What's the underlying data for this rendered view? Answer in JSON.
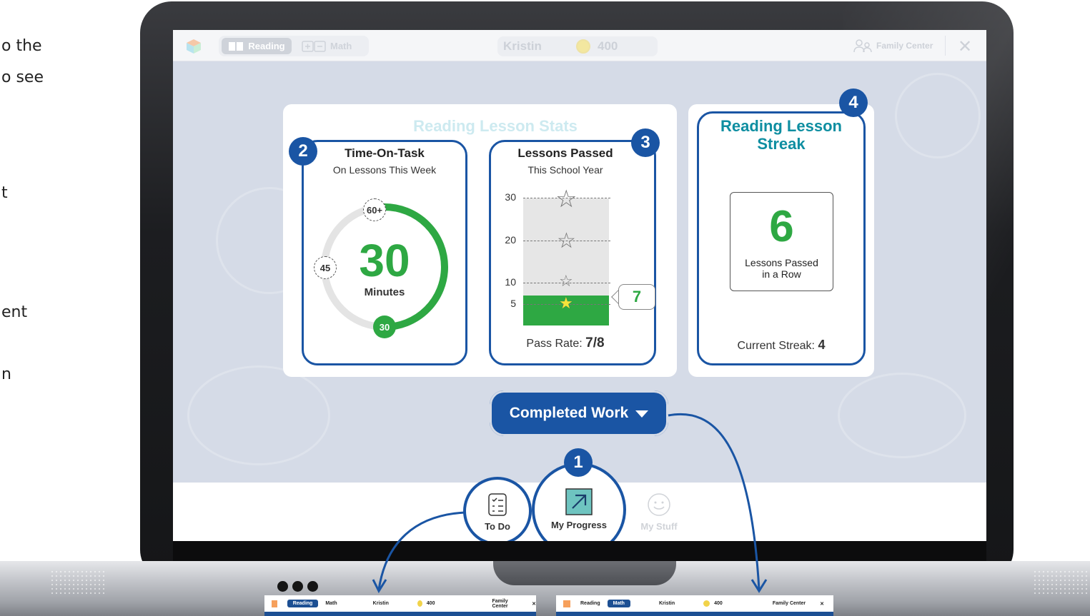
{
  "side_text": [
    "o the",
    "o see",
    "t",
    "ent",
    "n"
  ],
  "topbar": {
    "tab_reading": "Reading",
    "tab_math": "Math",
    "user_name": "Kristin",
    "coins": "400",
    "family_center": "Family Center",
    "close": "✕"
  },
  "stats": {
    "title": "Reading Lesson Stats",
    "time_on_task": {
      "badge": "2",
      "title": "Time-On-Task",
      "subtitle": "On Lessons This Week",
      "value": "30",
      "unit": "Minutes",
      "dial_labels": [
        "60+",
        "45",
        "30"
      ],
      "fraction_of_goal": 0.5
    },
    "lessons_passed": {
      "badge": "3",
      "title": "Lessons Passed",
      "subtitle": "This School Year",
      "ticks": [
        "30",
        "20",
        "10",
        "5"
      ],
      "value": "7",
      "value_number": 7,
      "max": 30,
      "pass_rate_label": "Pass Rate:",
      "pass_rate_value": "7/8"
    }
  },
  "streak": {
    "badge": "4",
    "title_line1": "Reading Lesson",
    "title_line2": "Streak",
    "value": "6",
    "sub_line1": "Lessons Passed",
    "sub_line2": "in a Row",
    "current_label": "Current Streak:",
    "current_value": "4"
  },
  "completed_work": "Completed Work",
  "nav": {
    "badge": "1",
    "todo": "To Do",
    "my_progress": "My Progress",
    "my_stuff": "My Stuff"
  },
  "thumb_left": {
    "reading": "Reading",
    "math": "Math",
    "user": "Kristin",
    "coins": "400",
    "family": "Family Center",
    "close": "✕"
  },
  "thumb_right": {
    "reading": "Reading",
    "math": "Math",
    "user": "Kristin",
    "coins": "400",
    "family": "Family Center",
    "close": "✕"
  },
  "colors": {
    "brand_blue": "#1a55a4",
    "green": "#2ea843",
    "teal": "#0e8ea1",
    "screen_bg": "#d5dbe7"
  }
}
